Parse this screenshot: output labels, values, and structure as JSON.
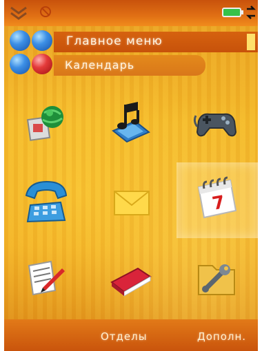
{
  "status_bar": {
    "left_icon": "chevron-down-icon",
    "cancel_icon": "cancel-icon",
    "battery_icon": "battery-icon",
    "signal_icon": "signal-icon",
    "battery_color": "#36c24a"
  },
  "header": {
    "title": "Главное меню",
    "subtitle": "Календарь"
  },
  "grid": [
    {
      "icon": "internet-icon"
    },
    {
      "icon": "media-player-icon"
    },
    {
      "icon": "games-icon"
    },
    {
      "icon": "calls-icon"
    },
    {
      "icon": "messages-icon"
    },
    {
      "icon": "calendar-icon",
      "selected": true,
      "calendar_day": "7"
    },
    {
      "icon": "notes-icon"
    },
    {
      "icon": "contacts-icon"
    },
    {
      "icon": "settings-icon"
    }
  ],
  "softkeys": {
    "left": "Отделы",
    "right": "Дополн."
  },
  "colors": {
    "accent": "#e06f14",
    "background": "#f4b928"
  }
}
